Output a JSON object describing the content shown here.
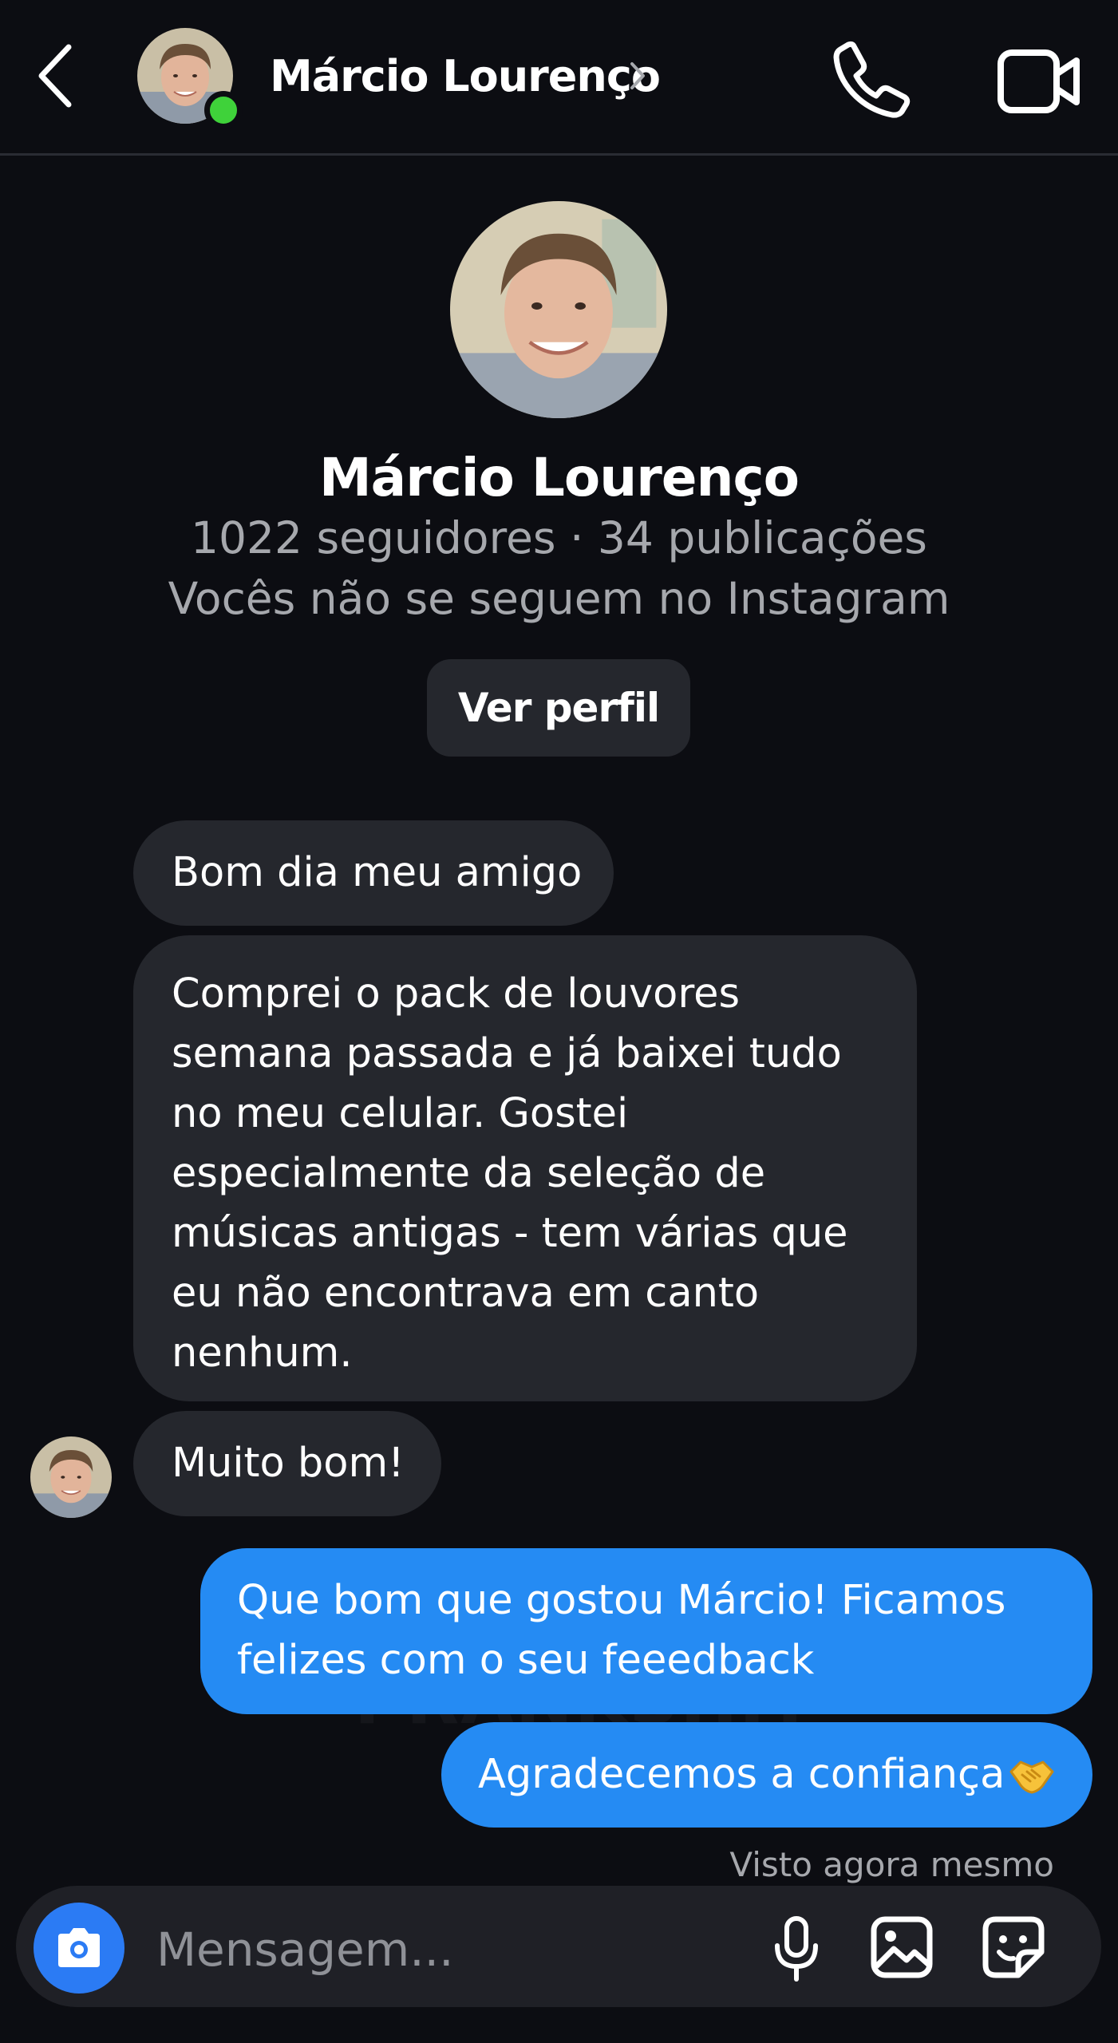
{
  "header": {
    "contact_name": "Márcio Lourenço",
    "back_icon": "chevron-left-icon",
    "call_icon": "phone-icon",
    "video_icon": "video-camera-icon",
    "online": true
  },
  "profile": {
    "name": "Márcio Lourenço",
    "stats": "1022 seguidores · 34 publicações",
    "relation": "Vocês não se seguem no Instagram",
    "view_profile_label": "Ver perfil"
  },
  "messages": [
    {
      "direction": "incoming",
      "text": "Bom dia meu amigo"
    },
    {
      "direction": "incoming",
      "lines": [
        "Comprei o pack de louvores",
        "semana passada e já baixei tudo",
        "no meu celular. Gostei",
        "especialmente da seleção de",
        "músicas antigas - tem várias que",
        "eu não encontrava em canto",
        "nenhum."
      ]
    },
    {
      "direction": "incoming",
      "text": "Muito bom!"
    },
    {
      "direction": "outgoing",
      "lines": [
        "Que bom que gostou Márcio! Ficamos",
        "felizes com o seu feeedback"
      ]
    },
    {
      "direction": "outgoing",
      "text": "Agradecemos a confiança",
      "emoji": "handshake-emoji"
    }
  ],
  "seen_label": "Visto agora mesmo",
  "watermark": "PRANKSHIT",
  "composer": {
    "placeholder": "Mensagem...",
    "camera_icon": "camera-icon",
    "mic_icon": "microphone-icon",
    "gallery_icon": "image-icon",
    "sticker_icon": "sticker-icon"
  },
  "colors": {
    "background": "#0c0d12",
    "incoming_bubble": "#25272d",
    "outgoing_bubble": "#258bf3",
    "camera_button": "#2b7bf4",
    "online_dot": "#3fd23a",
    "muted_text": "#a6a8ad"
  }
}
